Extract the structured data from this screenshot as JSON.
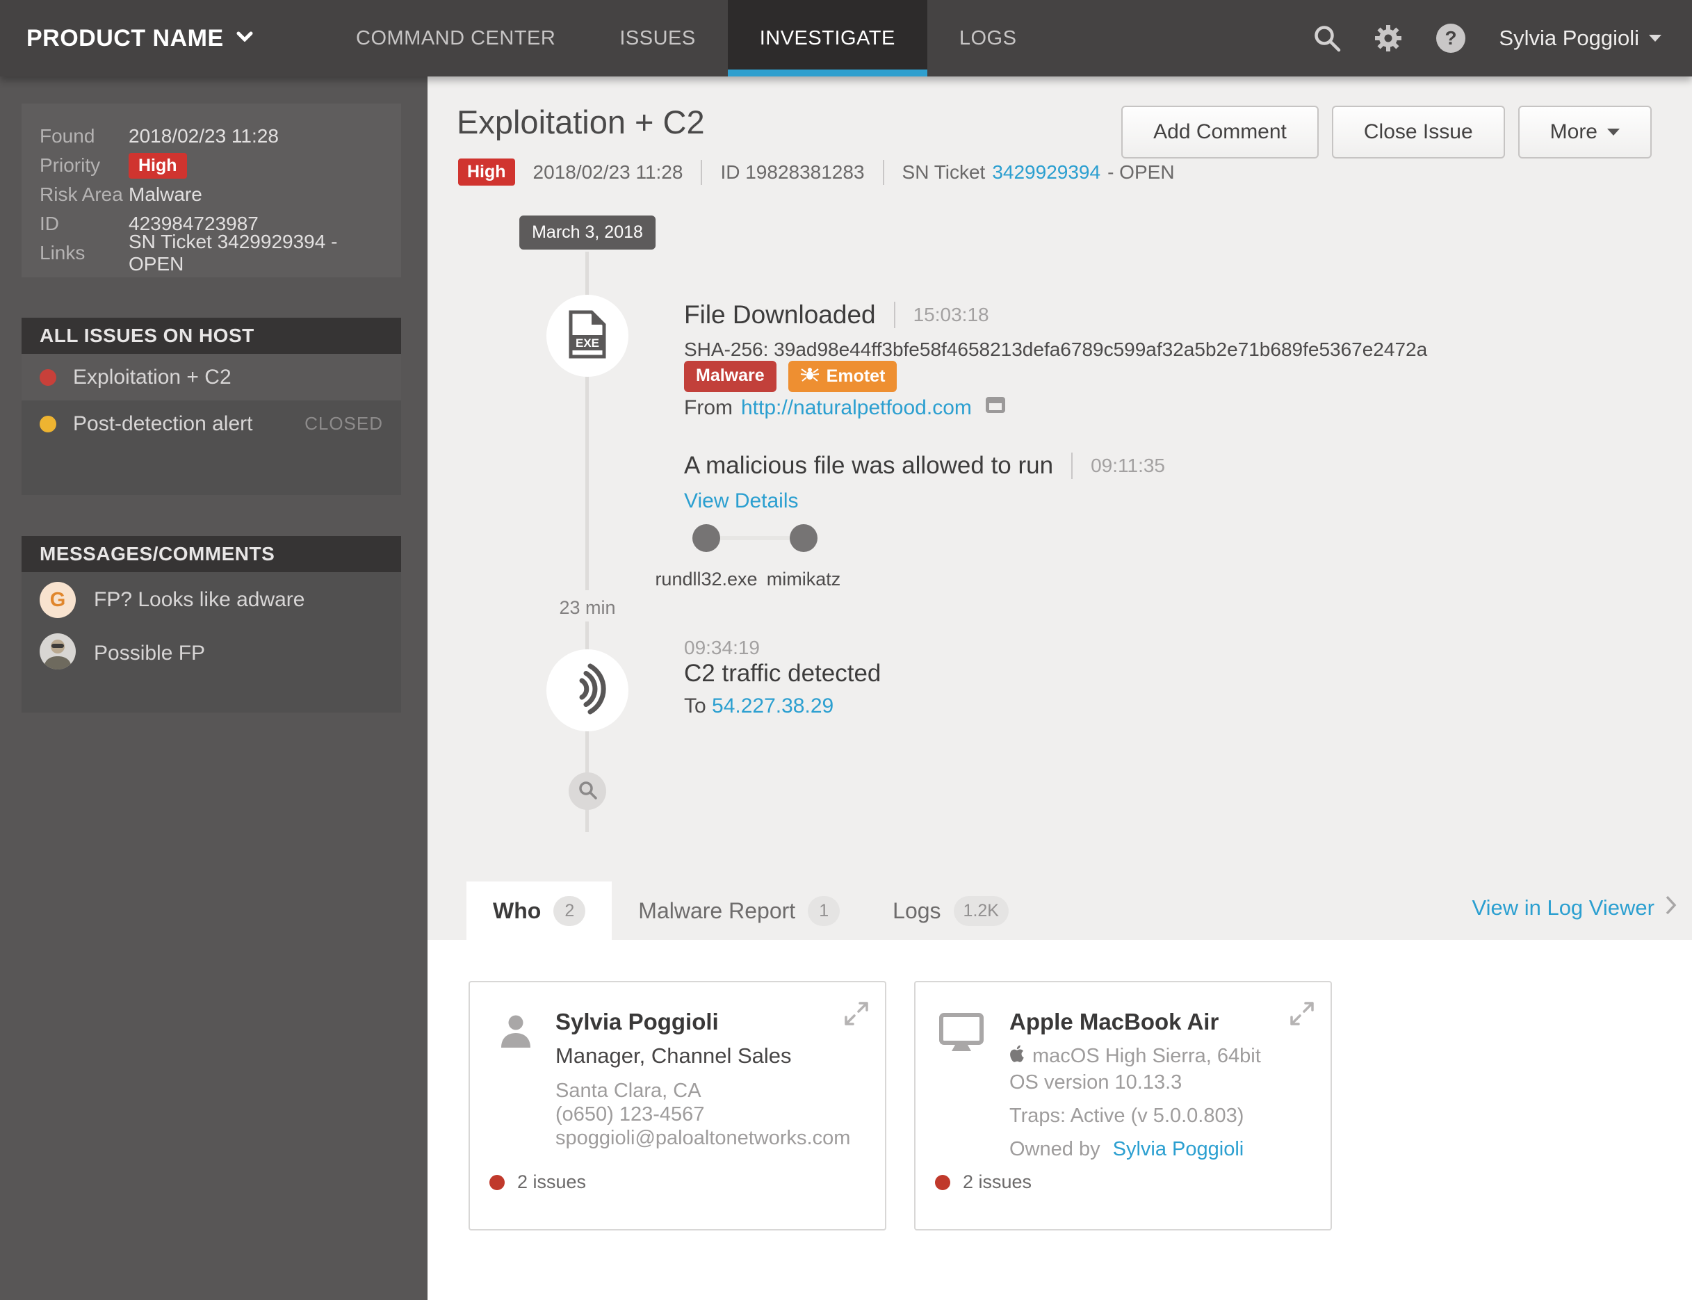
{
  "nav": {
    "product_name": "PRODUCT NAME",
    "items": [
      {
        "label": "COMMAND CENTER"
      },
      {
        "label": "ISSUES"
      },
      {
        "label": "INVESTIGATE"
      },
      {
        "label": "LOGS"
      }
    ],
    "user": "Sylvia Poggioli"
  },
  "sidebar": {
    "details": {
      "rows": [
        {
          "label": "Found",
          "value": "2018/02/23 11:28"
        },
        {
          "label": "Priority",
          "value": "High"
        },
        {
          "label": "Risk Area",
          "value": "Malware"
        },
        {
          "label": "ID",
          "value": "423984723987"
        },
        {
          "label": "Links",
          "value": "SN Ticket 3429929394 - OPEN"
        }
      ]
    },
    "issues_section": {
      "title": "ALL ISSUES ON HOST",
      "items": [
        {
          "label": "Exploitation + C2",
          "severity": "red",
          "status": ""
        },
        {
          "label": "Post-detection alert",
          "severity": "yellow",
          "status": "CLOSED"
        }
      ]
    },
    "comments_section": {
      "title": "MESSAGES/COMMENTS",
      "items": [
        {
          "avatar_letter": "G",
          "text": "FP? Looks like adware"
        },
        {
          "avatar_letter": "",
          "text": "Possible FP"
        }
      ]
    }
  },
  "header": {
    "title": "Exploitation + C2",
    "priority": "High",
    "timestamp": "2018/02/23 11:28",
    "id_label": "ID 19828381283",
    "ticket_prefix": "SN Ticket",
    "ticket_number": "3429929394",
    "ticket_status": "- OPEN",
    "buttons": {
      "add_comment": "Add Comment",
      "close_issue": "Close Issue",
      "more": "More"
    }
  },
  "timeline": {
    "date_badge": "March 3, 2018",
    "event_file": {
      "title": "File Downloaded",
      "time": "15:03:18",
      "sha": "SHA-256: 39ad98e44ff3bfe58f4658213defa6789c599af32a5b2e71b689fe5367e2472a",
      "badge_malware": "Malware",
      "badge_emotet": "Emotet",
      "from_label": "From",
      "from_url": "http://naturalpetfood.com"
    },
    "event_run": {
      "title": "A malicious file was allowed to run",
      "time": "09:11:35",
      "details_link": "View Details",
      "process_1": "rundll32.exe",
      "process_2": "mimikatz"
    },
    "gap_label": "23 min",
    "event_c2": {
      "time": "09:34:19",
      "title": "C2 traffic detected",
      "to_label": "To",
      "to_ip": "54.227.38.29"
    }
  },
  "tabs": {
    "items": [
      {
        "label": "Who",
        "count": "2"
      },
      {
        "label": "Malware Report",
        "count": "1"
      },
      {
        "label": "Logs",
        "count": "1.2K"
      }
    ],
    "log_viewer_link": "View in Log Viewer"
  },
  "cards": {
    "person": {
      "name": "Sylvia Poggioli",
      "title": "Manager, Channel Sales",
      "location": "Santa Clara, CA",
      "phone": "(o650) 123-4567",
      "email": "spoggioli@paloaltonetworks.com",
      "issues": "2 issues"
    },
    "device": {
      "name": "Apple MacBook Air",
      "os": "macOS High Sierra, 64bit",
      "os_version": "OS version 10.13.3",
      "traps": "Traps: Active (v 5.0.0.803)",
      "owned_by_label": "Owned by",
      "owner": "Sylvia Poggioli",
      "issues": "2 issues"
    }
  },
  "colors": {
    "accent_blue": "#2b9fd0",
    "nav_active_underline": "#2f9fce",
    "priority_red": "#d0342f",
    "badge_malware_red": "#c2403a",
    "badge_emotet_orange": "#ee8f31",
    "issue_dot_red": "#c8403a",
    "issue_dot_yellow": "#eeb431",
    "footer_dot_red": "#c0392b"
  },
  "icons": {
    "search": "magnifier",
    "settings": "gear",
    "help": "question-circle",
    "file_event": "exe-file",
    "network_event": "signal-waves",
    "timeline_end": "magnifier-small",
    "emotet": "spider",
    "from_url": "browser-window",
    "expand": "diagonal-arrows",
    "person": "person-silhouette",
    "device": "monitor",
    "os": "apple-logo"
  }
}
